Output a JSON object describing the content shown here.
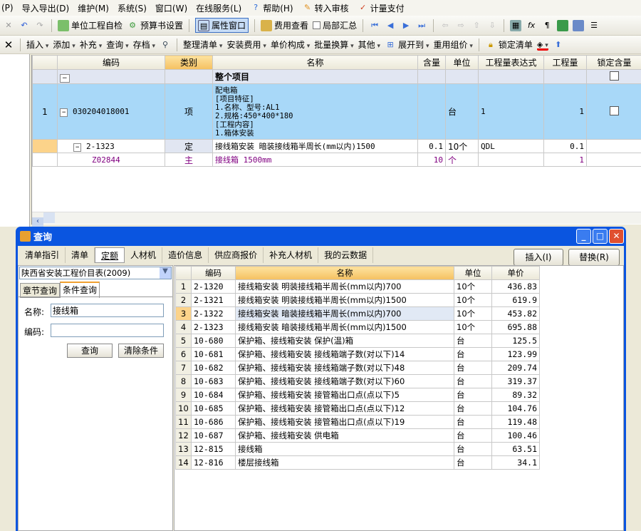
{
  "menu": [
    "(P)",
    "导入导出(D)",
    "维护(M)",
    "系统(S)",
    "窗口(W)",
    "在线服务(L)",
    "帮助(H)",
    "转入审核",
    "计量支付"
  ],
  "toolbar1": {
    "unit_check": "单位工程自检",
    "budget_settings": "预算书设置",
    "property_window": "属性窗口",
    "fee_view": "费用查看",
    "partial_summary": "局部汇总"
  },
  "toolbar2": {
    "insert": "插入",
    "add": "添加",
    "supplement": "补充",
    "query": "查询",
    "archive": "存档",
    "organize": "整理清单",
    "install_fee": "安装费用",
    "unit_price": "单价构成",
    "batch": "批量换算",
    "other": "其他",
    "expand": "展开到",
    "reuse": "重用组价",
    "lock": "锁定清单"
  },
  "grid": {
    "headers": [
      "编码",
      "类别",
      "名称",
      "含量",
      "单位",
      "工程量表达式",
      "工程量",
      "锁定含量"
    ],
    "group": "整个项目",
    "rows": [
      {
        "no": "1",
        "code": "030204018001",
        "type": "项",
        "name_lines": [
          "配电箱",
          "[项目特征]",
          "1.名称、型号:AL1",
          "2.规格:450*400*180",
          "[工程内容]",
          "1.箱体安装"
        ],
        "qty_ratio": "",
        "unit": "台",
        "expr": "1",
        "qty": "1"
      },
      {
        "no": "",
        "code": "2-1323",
        "type": "定",
        "name": "接线箱安装 暗装接线箱半周长(mm以内)1500",
        "qty_ratio": "0.1",
        "unit": "10个",
        "expr": "QDL",
        "qty": "0.1"
      },
      {
        "no": "",
        "code": "Z02844",
        "type": "主",
        "name": "接线箱 1500mm",
        "qty_ratio": "10",
        "unit": "个",
        "expr": "",
        "qty": "1"
      }
    ]
  },
  "dialog": {
    "title": "查询",
    "tabs": [
      "清单指引",
      "清单",
      "定额",
      "人材机",
      "造价信息",
      "供应商报价",
      "补充人材机",
      "我的云数据"
    ],
    "insert": "插入(I)",
    "replace": "替换(R)",
    "library": "陕西省安装工程价目表(2009)",
    "subtabs": [
      "章节查询",
      "条件查询"
    ],
    "name_label": "名称:",
    "name_value": "接线箱",
    "code_label": "编码:",
    "code_value": "",
    "query_btn": "查询",
    "clear_btn": "清除条件",
    "headers": [
      "编码",
      "名称",
      "单位",
      "单价"
    ],
    "rows": [
      [
        "1",
        "2-1320",
        "接线箱安装 明装接线箱半周长(mm以内)700",
        "10个",
        "436.83"
      ],
      [
        "2",
        "2-1321",
        "接线箱安装 明装接线箱半周长(mm以内)1500",
        "10个",
        "619.9"
      ],
      [
        "3",
        "2-1322",
        "接线箱安装 暗装接线箱半周长(mm以内)700",
        "10个",
        "453.82"
      ],
      [
        "4",
        "2-1323",
        "接线箱安装 暗装接线箱半周长(mm以内)1500",
        "10个",
        "695.88"
      ],
      [
        "5",
        "10-680",
        "保护箱、接线箱安装 保护(温)箱",
        "台",
        "125.5"
      ],
      [
        "6",
        "10-681",
        "保护箱、接线箱安装 接线箱端子数(对以下)14",
        "台",
        "123.99"
      ],
      [
        "7",
        "10-682",
        "保护箱、接线箱安装 接线箱端子数(对以下)48",
        "台",
        "209.74"
      ],
      [
        "8",
        "10-683",
        "保护箱、接线箱安装 接线箱端子数(对以下)60",
        "台",
        "319.37"
      ],
      [
        "9",
        "10-684",
        "保护箱、接线箱安装 接管箱出口点(点以下)5",
        "台",
        "89.32"
      ],
      [
        "10",
        "10-685",
        "保护箱、接线箱安装 接管箱出口点(点以下)12",
        "台",
        "104.76"
      ],
      [
        "11",
        "10-686",
        "保护箱、接线箱安装 接管箱出口点(点以下)19",
        "台",
        "119.48"
      ],
      [
        "12",
        "10-687",
        "保护箱、接线箱安装 供电箱",
        "台",
        "100.46"
      ],
      [
        "13",
        "12-815",
        "接线箱",
        "台",
        "63.51"
      ],
      [
        "14",
        "12-816",
        "楼层接线箱",
        "台",
        "34.1"
      ]
    ]
  }
}
